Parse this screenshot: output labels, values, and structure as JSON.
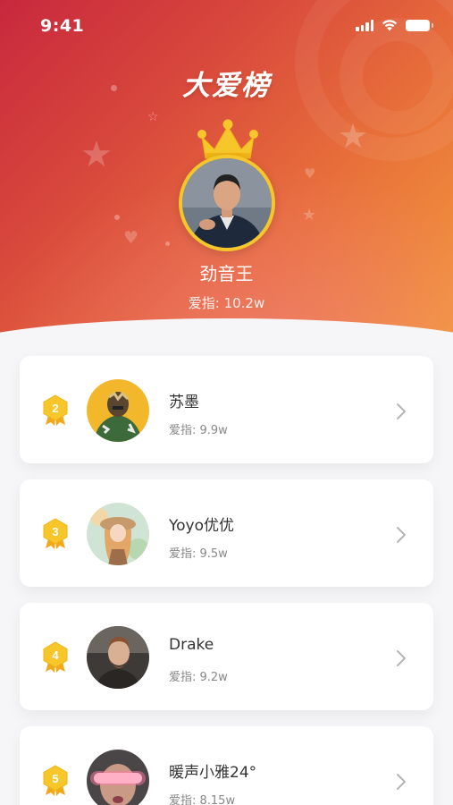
{
  "status_bar": {
    "time": "9:41"
  },
  "header": {
    "title": "大爱榜",
    "champion": {
      "name": "劲音王",
      "score": "爱指: 10.2w"
    }
  },
  "ranking": [
    {
      "rank": "2",
      "name": "苏墨",
      "score": "爱指: 9.9w"
    },
    {
      "rank": "3",
      "name": "Yoyo优优",
      "score": "爱指: 9.5w"
    },
    {
      "rank": "4",
      "name": "Drake",
      "score": "爱指: 9.2w"
    },
    {
      "rank": "5",
      "name": "暖声小雅24°",
      "score": "爱指: 8.15w"
    }
  ],
  "colors": {
    "gold": "#f6c62a",
    "header_start": "#c8283d",
    "header_end": "#f39b3c"
  }
}
